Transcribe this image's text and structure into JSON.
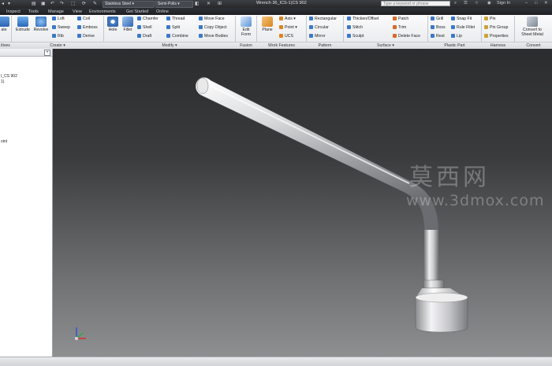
{
  "titlebar": {
    "material": "Stainless Steel",
    "appearance": "Semi-Polis",
    "document": "Wrench 36_ICS-1(CS 902",
    "search_placeholder": "Type a keyword or phrase",
    "sign_in": "Sign In"
  },
  "tabs": [
    "Inspect",
    "Tools",
    "Manage",
    "View",
    "Environments",
    "Get Started",
    "Online"
  ],
  "ribbon": {
    "create": {
      "left_cut": "ate",
      "extrude": "Extrude",
      "revolve": "Revolve",
      "loft": "Loft",
      "sweep": "Sweep",
      "rib": "Rib",
      "coil": "Coil",
      "emboss": "Emboss",
      "derive": "Derive"
    },
    "modify": {
      "hole": "Hole",
      "fillet": "Fillet",
      "chamfer": "Chamfer",
      "shell": "Shell",
      "draft": "Draft",
      "thread": "Thread",
      "split": "Split",
      "combine": "Combine",
      "move_face": "Move Face",
      "copy_object": "Copy Object",
      "move_bodies": "Move Bodies"
    },
    "fusion": {
      "edit_form_1": "Edit",
      "edit_form_2": "Form"
    },
    "work_features": {
      "plane": "Plane",
      "axis": "Axis",
      "point": "Point",
      "ucs": "UCS"
    },
    "pattern": {
      "rectangular": "Rectangular",
      "circular": "Circular",
      "mirror": "Mirror"
    },
    "surface": {
      "thicken": "Thicken/Offset",
      "stitch": "Stitch",
      "sculpt": "Sculpt",
      "patch": "Patch",
      "trim": "Trim",
      "delete_face": "Delete Face"
    },
    "plastic_part": {
      "grill": "Grill",
      "boss": "Boss",
      "rest": "Rest",
      "snap_fit": "Snap Fit",
      "rule_fillet": "Rule Fillet",
      "lip": "Lip"
    },
    "harness": {
      "pin": "Pin",
      "pin_group": "Pin Group",
      "properties": "Properties"
    },
    "convert": {
      "line1": "Convert to",
      "line2": "Sheet Metal"
    },
    "panels": {
      "left_cut": "itives",
      "create": "Create",
      "modify": "Modify",
      "fusion": "Fusion",
      "work_features": "Work Features",
      "pattern": "Pattern",
      "surface": "Surface",
      "plastic_part": "Plastic Part",
      "harness": "Harness",
      "convert": "Convert"
    }
  },
  "browser": {
    "items": [
      "I_CS 902",
      "1)",
      "",
      "",
      "",
      "",
      "",
      "",
      "oint"
    ]
  },
  "watermark": {
    "cn": "莫西网",
    "url": "www.3dmox.com"
  },
  "colors": {
    "titlebar": "#2c2f33",
    "viewport_top": "#2b2c2e",
    "viewport_bottom": "#8e8f91",
    "accent": "#2b6cb8"
  }
}
